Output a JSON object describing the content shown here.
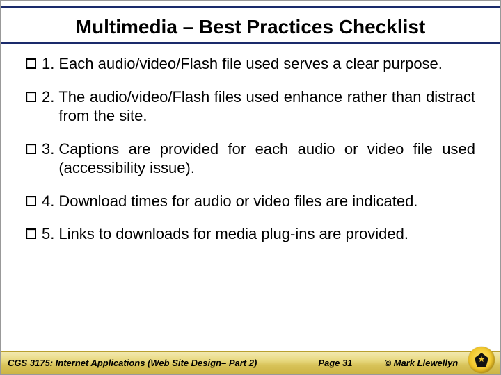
{
  "title": "Multimedia – Best Practices Checklist",
  "items": [
    {
      "num": "1.",
      "text": "Each audio/video/Flash file used serves a clear purpose."
    },
    {
      "num": "2.",
      "text": "The audio/video/Flash files used enhance rather than distract from the site."
    },
    {
      "num": "3.",
      "text": "Captions are provided for each audio or video file used (accessibility issue)."
    },
    {
      "num": "4.",
      "text": "Download times for audio or video files are indicated."
    },
    {
      "num": "5.",
      "text": "Links to downloads for media plug-ins are provided."
    }
  ],
  "footer": {
    "course": "CGS 3175: Internet Applications (Web Site Design– Part 2)",
    "page": "Page 31",
    "copyright": "© Mark Llewellyn"
  }
}
